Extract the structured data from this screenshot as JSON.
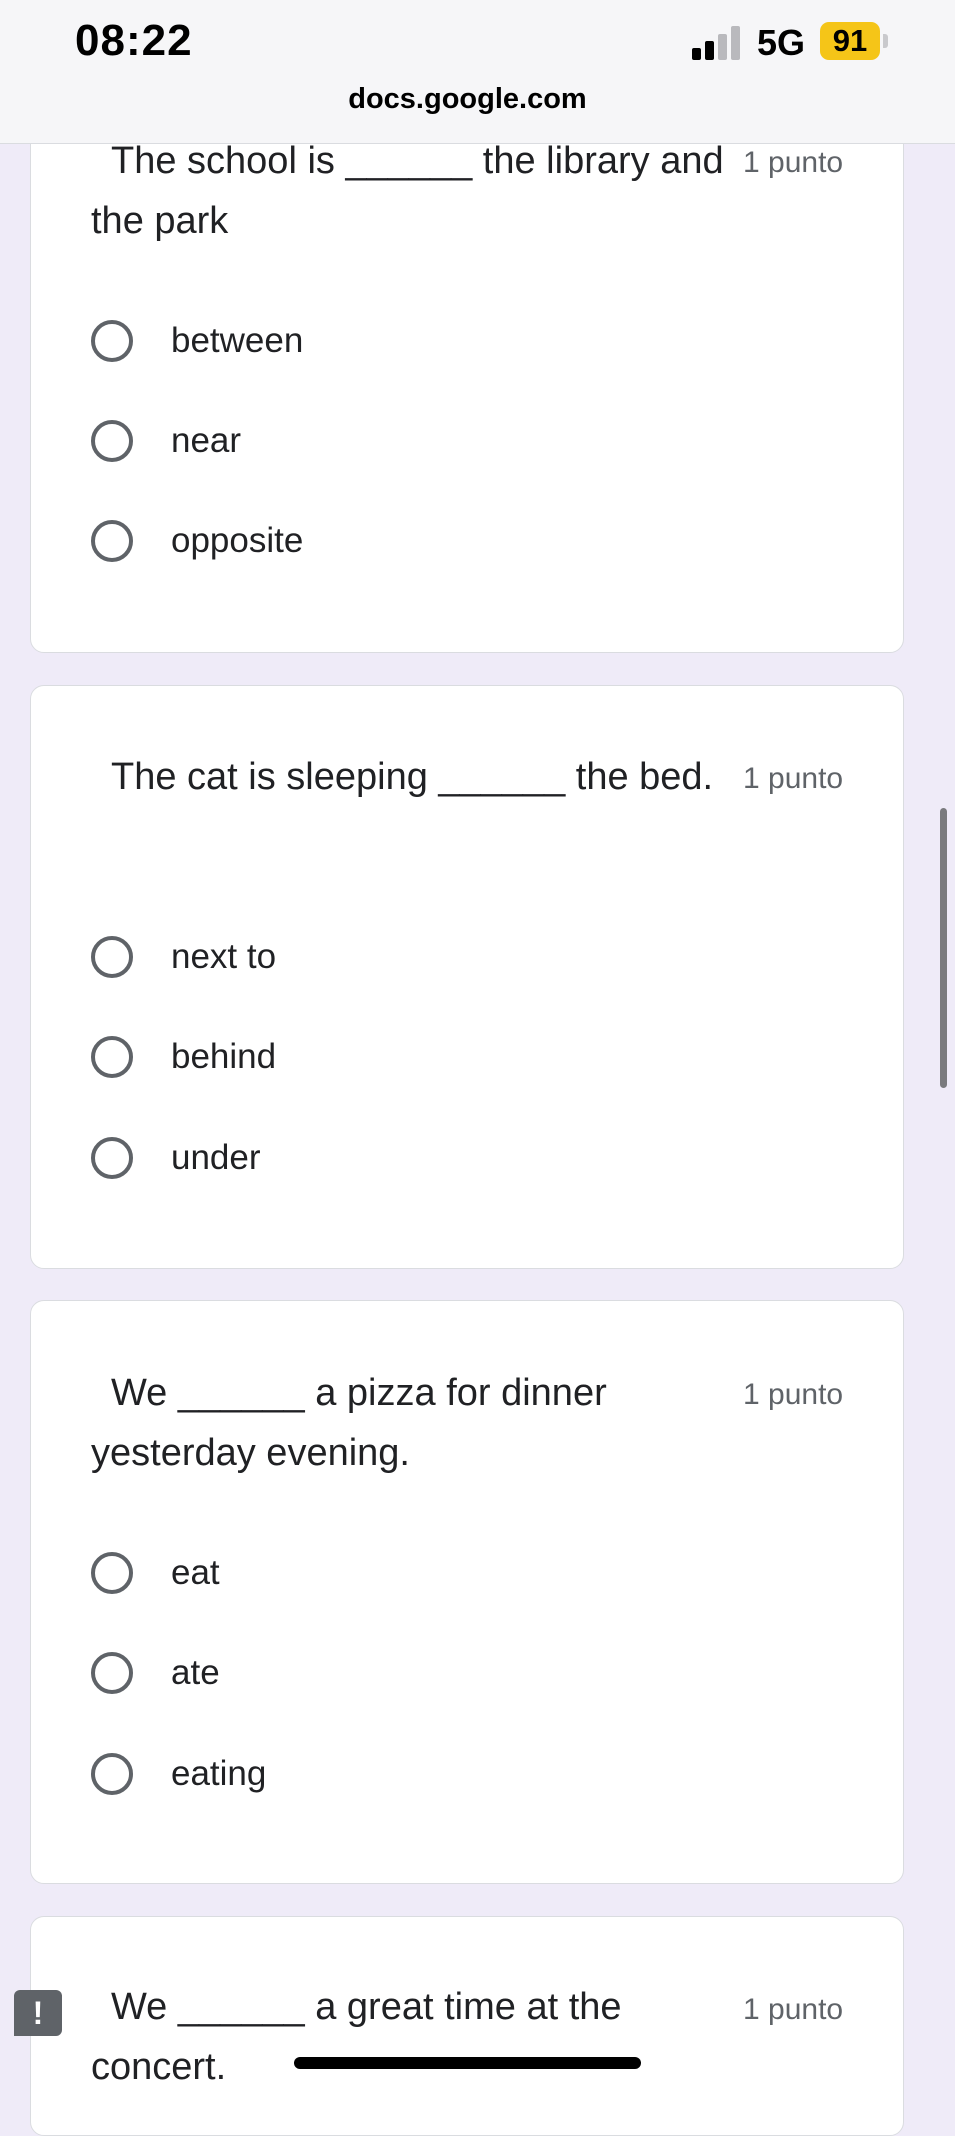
{
  "status_bar": {
    "time": "08:22",
    "network": "5G",
    "battery": "91"
  },
  "browser": {
    "url": "docs.google.com"
  },
  "questions": [
    {
      "text": "The school is ______ the library and the park",
      "points": "1 punto",
      "options": [
        "between",
        "near",
        "opposite"
      ]
    },
    {
      "text": "The cat is sleeping ______ the bed.",
      "points": "1 punto",
      "options": [
        "next to",
        "behind",
        "under"
      ]
    },
    {
      "text": "We ______ a pizza for dinner yesterday evening.",
      "points": "1 punto",
      "options": [
        "eat",
        "ate",
        "eating"
      ]
    },
    {
      "text": "We ______ a great time at the concert.",
      "points": "1 punto",
      "options": []
    }
  ],
  "feedback": {
    "symbol": "!"
  }
}
